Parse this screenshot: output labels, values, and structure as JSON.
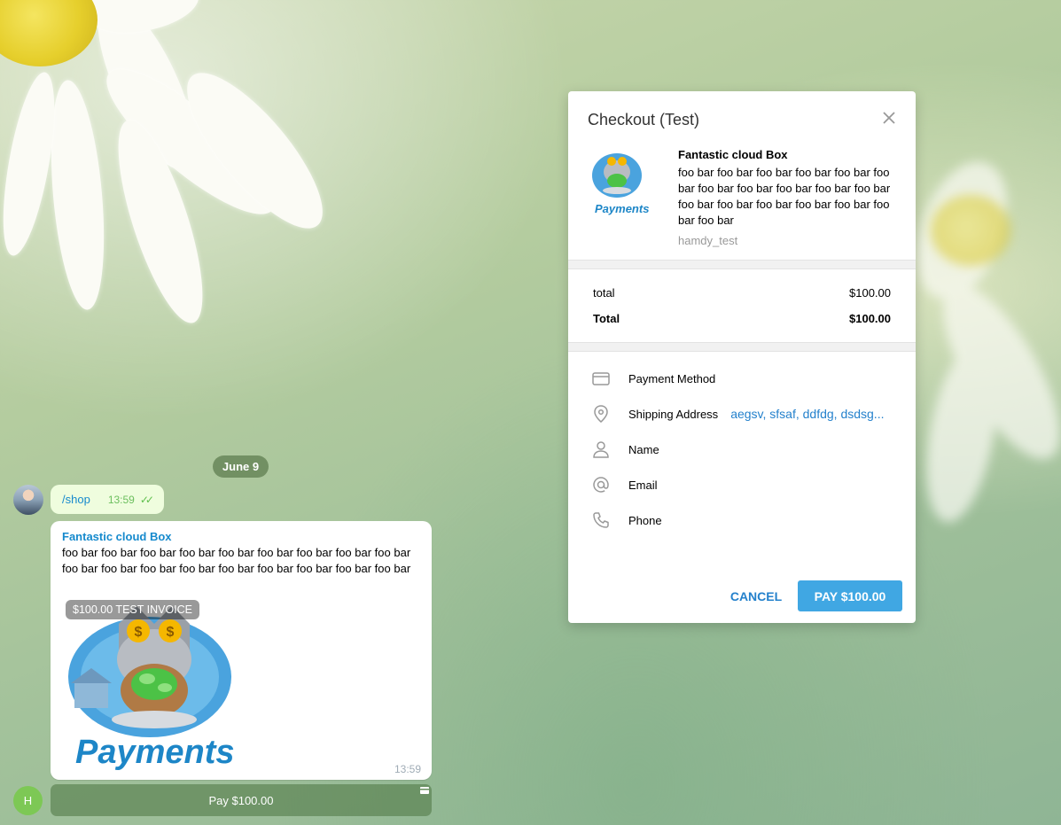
{
  "chat": {
    "date_label": "June 9",
    "outgoing": {
      "text": "/shop",
      "time": "13:59"
    },
    "invoice": {
      "title": "Fantastic cloud Box",
      "description": "foo bar foo bar foo bar foo bar foo bar foo bar foo bar foo bar foo bar foo bar foo bar foo bar foo bar foo bar foo bar foo bar foo bar foo bar",
      "badge": "$100.00 TEST INVOICE",
      "image_label": "Payments",
      "time": "13:59"
    },
    "avatar_initial": "H",
    "pay_button": "Pay $100.00"
  },
  "checkout": {
    "title": "Checkout (Test)",
    "product": {
      "title": "Fantastic cloud Box",
      "description": "foo bar foo bar foo bar foo bar foo bar foo bar foo bar foo bar foo bar foo bar foo bar foo bar foo bar foo bar foo bar foo bar foo bar foo bar",
      "image_label": "Payments",
      "bot": "hamdy_test"
    },
    "prices": [
      {
        "label": "total",
        "amount": "$100.00"
      },
      {
        "label": "Total",
        "amount": "$100.00"
      }
    ],
    "fields": [
      {
        "label": "Payment Method",
        "value": "",
        "icon": "card-icon"
      },
      {
        "label": "Shipping Address",
        "value": "aegsv, sfsaf, ddfdg, dsdsg...",
        "icon": "location-pin-icon"
      },
      {
        "label": "Name",
        "value": "",
        "icon": "person-icon"
      },
      {
        "label": "Email",
        "value": "",
        "icon": "at-icon"
      },
      {
        "label": "Phone",
        "value": "",
        "icon": "phone-icon"
      }
    ],
    "cancel_label": "CANCEL",
    "pay_label": "PAY $100.00"
  },
  "colors": {
    "accent": "#40a7e3",
    "link": "#2481cc",
    "bubble_out": "#effdde",
    "title_blue": "#168acd"
  }
}
